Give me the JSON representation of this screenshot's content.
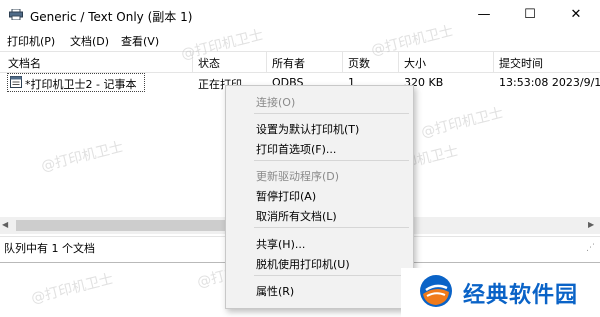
{
  "window": {
    "title": "Generic / Text Only (副本 1)",
    "controls": {
      "minimize": "—",
      "maximize": "☐",
      "close": "✕"
    }
  },
  "menu": [
    "打印机(P)",
    "文档(D)",
    "查看(V)"
  ],
  "columns": [
    "文档名",
    "状态",
    "所有者",
    "页数",
    "大小",
    "提交时间"
  ],
  "rows": [
    {
      "name": "*打印机卫士2 - 记事本",
      "status": "正在打印",
      "owner": "ODBS",
      "pages": "1",
      "size": "320 KB",
      "time": "13:53:08  2023/9/1"
    }
  ],
  "status_bar": "队列中有 1 个文档",
  "context_menu": {
    "connect": "连接(O)",
    "set_default": "设置为默认打印机(T)",
    "preferences": "打印首选项(F)...",
    "update_driver": "更新驱动程序(D)",
    "pause": "暂停打印(A)",
    "cancel_all": "取消所有文档(L)",
    "share": "共享(H)...",
    "offline": "脱机使用打印机(U)",
    "properties": "属性(R)"
  },
  "watermark": "@打印机卫士",
  "brand": {
    "text": "经典软件园"
  },
  "colors": {
    "brand_blue": "#0a63c7",
    "brand_orange": "#f07a1a",
    "menu_bg": "#f2f2f2"
  },
  "icons": [
    "printer-icon",
    "document-icon",
    "minimize-icon",
    "maximize-icon",
    "close-icon",
    "brand-logo-icon"
  ]
}
